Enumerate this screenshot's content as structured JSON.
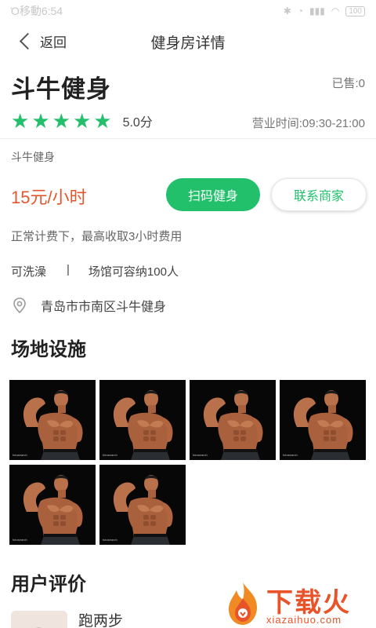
{
  "status_bar": {
    "carrier_time": "Ό移動6:54",
    "battery": "100"
  },
  "nav": {
    "back_label": "返回",
    "title": "健身房详情"
  },
  "gym": {
    "name": "斗牛健身",
    "sold": "已售:0",
    "rating": 5,
    "score": "5.0分",
    "hours": "营业时间:09:30-21:00",
    "sub_name": "斗牛健身",
    "price": "15元/小时",
    "billing_note": "正常计费下，最高收取3小时费用",
    "amenity_1": "可洗澡",
    "amenity_sep": "|",
    "amenity_2": "场馆可容纳100人",
    "address": "青岛市市南区斗牛健身"
  },
  "buttons": {
    "scan": "扫码健身",
    "contact": "联系商家"
  },
  "sections": {
    "facilities": "场地设施",
    "reviews": "用户评价"
  },
  "photos_count": 6,
  "review": {
    "user": "跑两步"
  },
  "watermark": {
    "text": "下载火",
    "url": "xiazaihuo.com"
  },
  "colors": {
    "accent": "#22c06b",
    "price": "#e4572e"
  }
}
